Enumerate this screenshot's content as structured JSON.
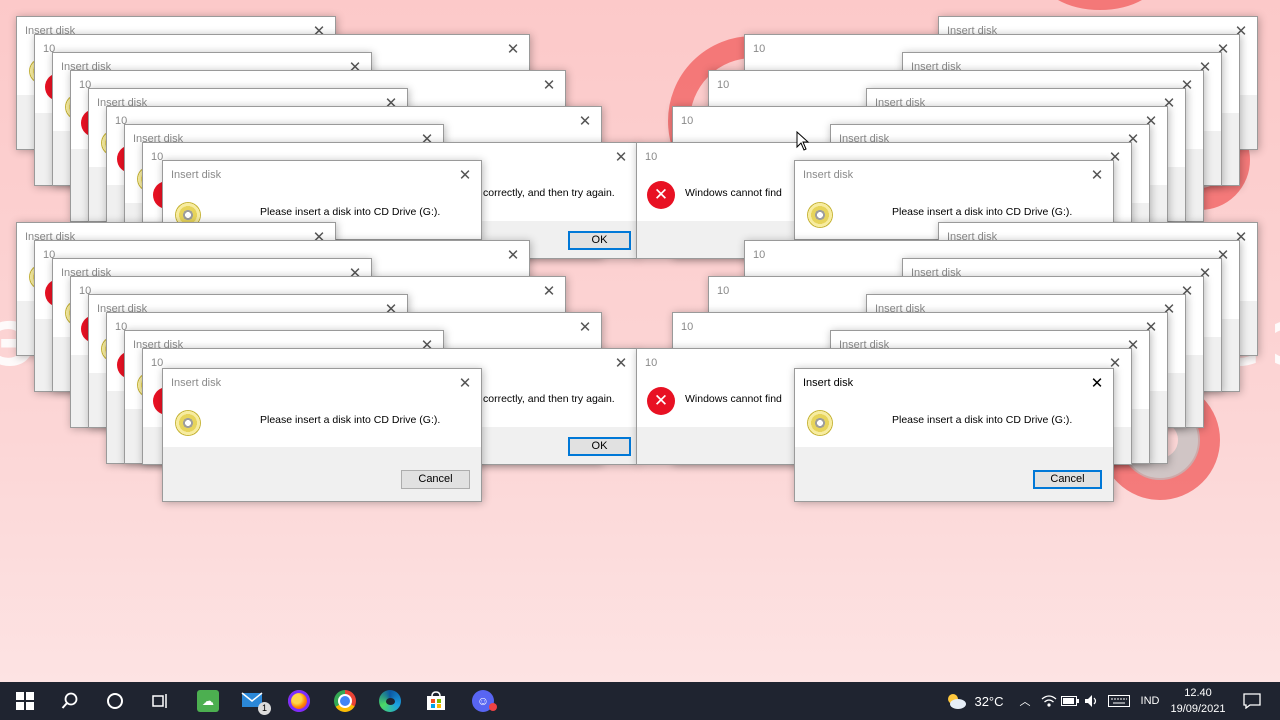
{
  "dialogs": {
    "insert": {
      "title": "Insert disk",
      "message": "Please insert a disk into CD Drive (G:).",
      "cancel_label": "Cancel"
    },
    "error": {
      "title": "10",
      "message_left": "Windows cannot find",
      "message_right": "correctly, and then try again.",
      "ok_label": "OK"
    }
  },
  "taskbar": {
    "weather_temp": "32°C",
    "language": "IND",
    "clock_time": "12.40",
    "clock_date": "19/09/2021",
    "mail_badge": "1",
    "icons": [
      "start-icon",
      "search-icon",
      "cortana-icon",
      "task-view-icon",
      "green-app-icon",
      "mail-icon",
      "firefox-icon",
      "chrome-icon",
      "edge-icon",
      "store-icon",
      "discord-icon"
    ]
  },
  "colors": {
    "accent": "#0078d7",
    "error_red": "#e81123",
    "taskbar": "#1f2430",
    "wallpaper": "#fcc9c9"
  }
}
